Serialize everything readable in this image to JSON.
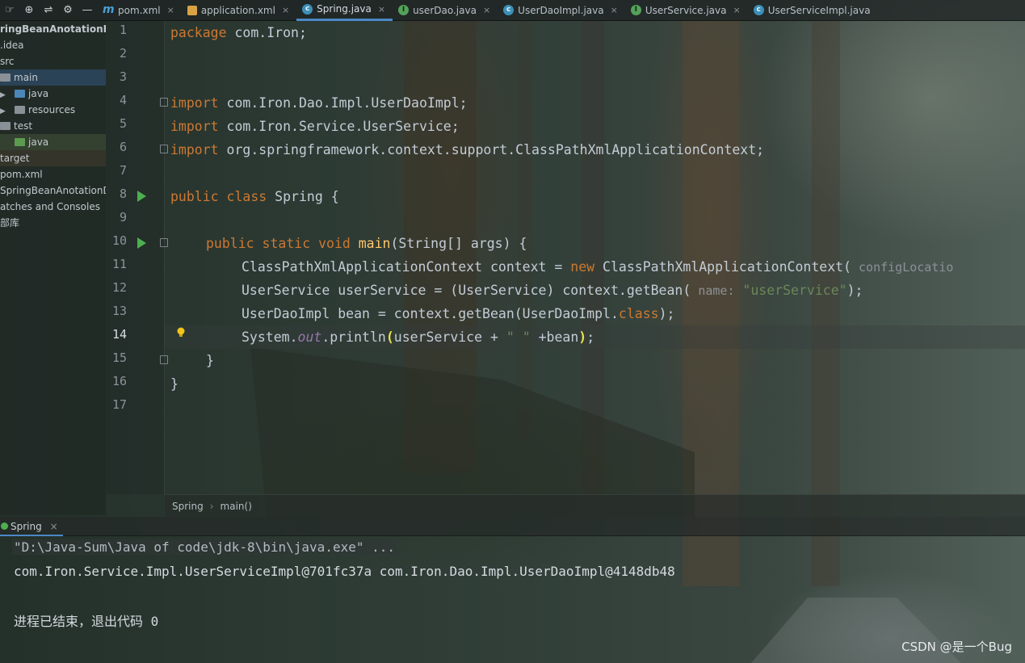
{
  "tabbar": {
    "tabs": [
      {
        "icon": "maven-icon",
        "label": "pom.xml",
        "active": false
      },
      {
        "icon": "xml-file-icon",
        "label": "application.xml",
        "active": false
      },
      {
        "icon": "class-icon",
        "label": "Spring.java",
        "active": true
      },
      {
        "icon": "interface-icon",
        "label": "userDao.java",
        "active": false
      },
      {
        "icon": "class-icon",
        "label": "UserDaoImpl.java",
        "active": false
      },
      {
        "icon": "interface-icon",
        "label": "UserService.java",
        "active": false
      },
      {
        "icon": "class-icon",
        "label": "UserServiceImpl.java",
        "active": false
      }
    ]
  },
  "project_tree": {
    "items": [
      {
        "label": "ringBeanAnotationDe",
        "bold": true
      },
      {
        "label": ".idea"
      },
      {
        "label": "src"
      },
      {
        "label": "main",
        "selected": true
      },
      {
        "label": "java"
      },
      {
        "label": "resources"
      },
      {
        "label": "test"
      },
      {
        "label": "java"
      },
      {
        "label": "target"
      },
      {
        "label": "pom.xml"
      },
      {
        "label": "SpringBeanAnotationD"
      },
      {
        "label": "atches and Consoles"
      },
      {
        "label": "部库"
      }
    ]
  },
  "editor": {
    "line_numbers": [
      "1",
      "2",
      "3",
      "4",
      "5",
      "6",
      "7",
      "8",
      "9",
      "10",
      "11",
      "12",
      "13",
      "14",
      "15",
      "16",
      "17"
    ],
    "current_line": "14",
    "code": {
      "l1_kw": "package",
      "l1_rest": " com.Iron;",
      "l4_kw": "import",
      "l4_rest": " com.Iron.Dao.Impl.UserDaoImpl;",
      "l5_kw": "import",
      "l5_rest": " com.Iron.Service.UserService;",
      "l6_kw": "import",
      "l6_rest": " org.springframework.context.support.ClassPathXmlApplicationContext;",
      "l8_kw": "public class",
      "l8_rest": " Spring {",
      "l10_kw": "public static void",
      "l10_fn": "main",
      "l10_rest": "(String[] args) {",
      "l11_a": "ClassPathXmlApplicationContext context = ",
      "l11_kw": "new",
      "l11_b": " ClassPathXmlApplicationContext(",
      "l11_hint": " configLocatio",
      "l12_a": "UserService userService = (UserService) context.getBean(",
      "l12_hint": " name:",
      "l12_str": " \"userService\"",
      "l12_b": ");",
      "l13_a": "UserDaoImpl bean = context.getBean(UserDaoImpl.",
      "l13_kw": "class",
      "l13_b": ");",
      "l14_a": "System.",
      "l14_it": "out",
      "l14_b": ".println",
      "l14_p1": "(",
      "l14_c": "userService + ",
      "l14_str": "\" \"",
      "l14_d": " +bean",
      "l14_p2": ")",
      "l14_e": ";",
      "l15": "}",
      "l16": "}"
    },
    "breadcrumb": [
      "Spring",
      "main()"
    ]
  },
  "run_panel": {
    "tab_label": "Spring",
    "command": "\"D:\\Java-Sum\\Java of code\\jdk-8\\bin\\java.exe\" ...",
    "result": "com.Iron.Service.Impl.UserServiceImpl@701fc37a com.Iron.Dao.Impl.UserDaoImpl@4148db48",
    "exit": "进程已结束，退出代码 0"
  },
  "watermark": "CSDN @是一个Bug"
}
